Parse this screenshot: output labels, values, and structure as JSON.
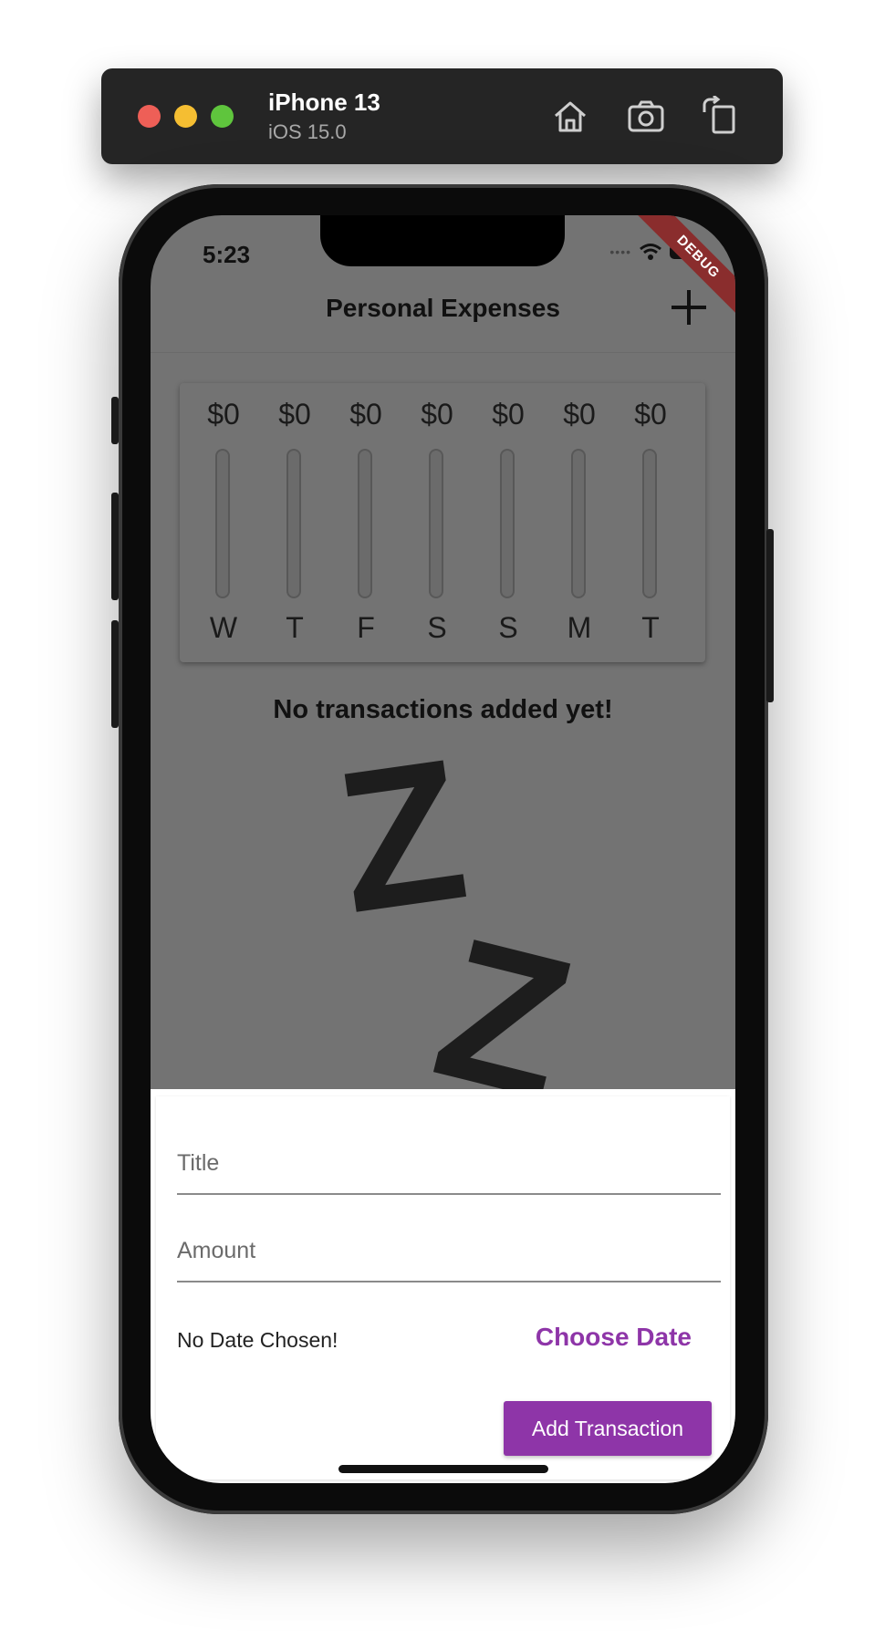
{
  "simulator": {
    "device_name": "iPhone 13",
    "os_version": "iOS 15.0",
    "icons": [
      "home-icon",
      "screenshot-icon",
      "rotate-icon"
    ]
  },
  "status_bar": {
    "time": "5:23",
    "debug_banner": "DEBUG"
  },
  "appbar": {
    "title": "Personal Expenses",
    "action_icon": "add-icon"
  },
  "chart": {
    "bars": [
      {
        "amount": "$0",
        "day": "W",
        "fill_fraction": 0
      },
      {
        "amount": "$0",
        "day": "T",
        "fill_fraction": 0
      },
      {
        "amount": "$0",
        "day": "F",
        "fill_fraction": 0
      },
      {
        "amount": "$0",
        "day": "S",
        "fill_fraction": 0
      },
      {
        "amount": "$0",
        "day": "S",
        "fill_fraction": 0
      },
      {
        "amount": "$0",
        "day": "M",
        "fill_fraction": 0
      },
      {
        "amount": "$0",
        "day": "T",
        "fill_fraction": 0
      }
    ]
  },
  "empty_state": {
    "message": "No transactions added yet!",
    "z1": "Z",
    "z2": "Z"
  },
  "form": {
    "title_placeholder": "Title",
    "title_value": "",
    "amount_placeholder": "Amount",
    "amount_value": "",
    "date_label": "No Date Chosen!",
    "choose_date_label": "Choose Date",
    "submit_label": "Add Transaction"
  },
  "colors": {
    "accent": "#8e35a8",
    "overlay": "#737373",
    "debug": "#8a2d2d"
  }
}
